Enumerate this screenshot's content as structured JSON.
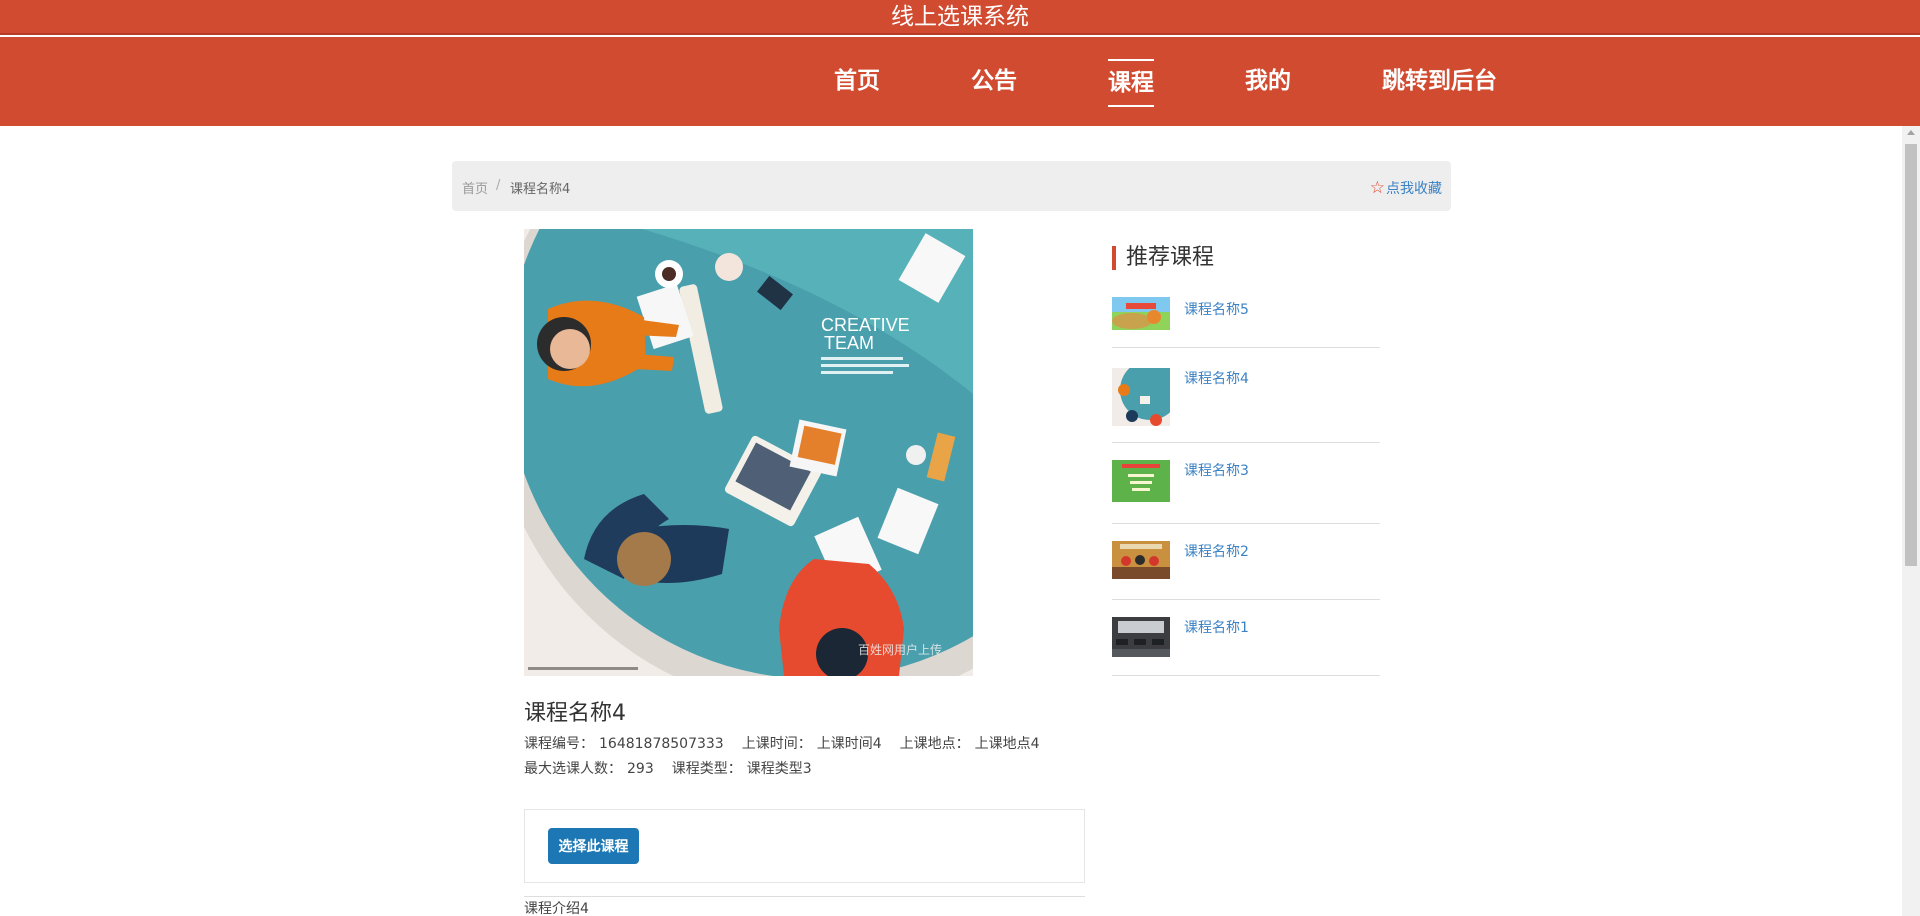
{
  "header": {
    "site_title": "线上选课系统"
  },
  "nav": {
    "home": "首页",
    "notice": "公告",
    "course": "课程",
    "mine": "我的",
    "admin": "跳转到后台",
    "active": "课程"
  },
  "breadcrumb": {
    "home": "首页",
    "separator": "/",
    "current": "课程名称4"
  },
  "favorite": {
    "icon": "star-outline-icon",
    "label": "点我收藏"
  },
  "course": {
    "image_text": {
      "line1": "CREATIVE",
      "line2": "TEAM",
      "watermark": "百姓网用户上传"
    },
    "title": "课程名称4",
    "code_label": "课程编号：",
    "code_value": "16481878507333",
    "time_label": "上课时间：",
    "time_value": "上课时间4",
    "place_label": "上课地点：",
    "place_value": "上课地点4",
    "max_label": "最大选课人数：",
    "max_value": "293",
    "type_label": "课程类型：",
    "type_value": "课程类型3",
    "select_button": "选择此课程",
    "intro": "课程介绍4"
  },
  "recommend": {
    "title": "推荐课程",
    "items": [
      {
        "label": "课程名称5"
      },
      {
        "label": "课程名称4"
      },
      {
        "label": "课程名称3"
      },
      {
        "label": "课程名称2"
      },
      {
        "label": "课程名称1"
      }
    ]
  },
  "colors": {
    "brand": "#d14b31",
    "link": "#3c82c4",
    "button": "#1c77b4"
  }
}
